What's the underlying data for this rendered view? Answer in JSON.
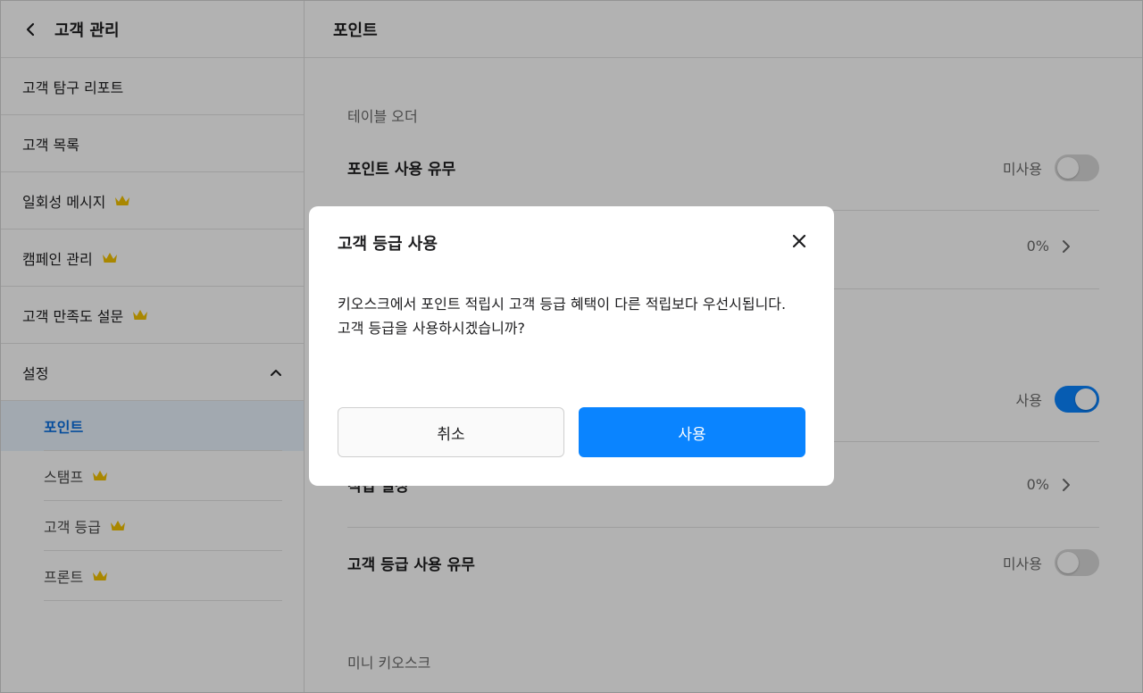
{
  "sidebar": {
    "title": "고객 관리",
    "items": [
      {
        "label": "고객 탐구 리포트",
        "premium": false
      },
      {
        "label": "고객 목록",
        "premium": false
      },
      {
        "label": "일회성 메시지",
        "premium": true
      },
      {
        "label": "캠페인 관리",
        "premium": true
      },
      {
        "label": "고객 만족도 설문",
        "premium": true
      }
    ],
    "settings_label": "설정",
    "sub_items": [
      {
        "label": "포인트",
        "premium": false,
        "active": true
      },
      {
        "label": "스탬프",
        "premium": true,
        "active": false
      },
      {
        "label": "고객 등급",
        "premium": true,
        "active": false
      },
      {
        "label": "프론트",
        "premium": true,
        "active": false
      }
    ]
  },
  "main": {
    "title": "포인트",
    "group_table_order": "테이블 오더",
    "row_point_use_label": "포인트 사용 유무",
    "row_point_use_status": "미사용",
    "row_rate_1_value": "0%",
    "row_kiosk_toggle_status": "사용",
    "row_earn_setting_label": "적립 설정",
    "row_earn_setting_value": "0%",
    "row_grade_use_label": "고객 등급 사용 유무",
    "row_grade_use_status": "미사용",
    "group_mini_kiosk": "미니 키오스크"
  },
  "modal": {
    "title": "고객 등급 사용",
    "body_line1": "키오스크에서 포인트 적립시 고객 등급 혜택이 다른 적립보다 우선시됩니다.",
    "body_line2": "고객 등급을 사용하시겠습니까?",
    "cancel_label": "취소",
    "confirm_label": "사용"
  },
  "colors": {
    "accent": "#0a84ff",
    "active_text": "#0a6fe0",
    "crown": "#f2c200",
    "overlay": "rgba(0,0,0,0.3)"
  }
}
